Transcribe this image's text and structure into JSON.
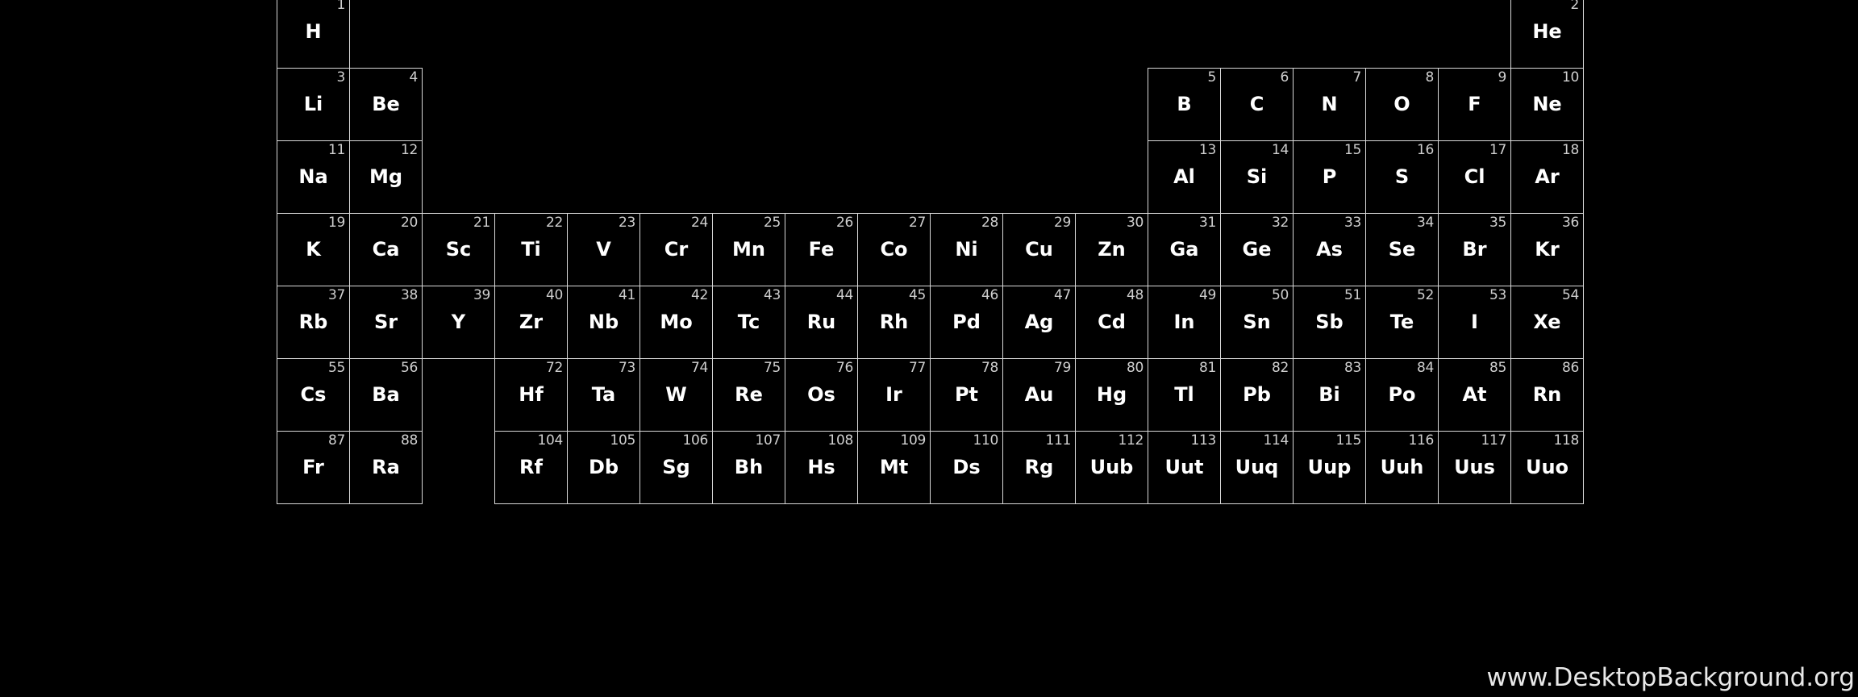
{
  "watermark": "www.DesktopBackground.org",
  "colors": {
    "background": "#000000",
    "grid_line": "#d8d8d8",
    "symbol": "#ffffff",
    "number": "#cfcfcf"
  },
  "elements": [
    {
      "n": "1",
      "s": "H",
      "period": 1,
      "group": 1
    },
    {
      "n": "2",
      "s": "He",
      "period": 1,
      "group": 18
    },
    {
      "n": "3",
      "s": "Li",
      "period": 2,
      "group": 1
    },
    {
      "n": "4",
      "s": "Be",
      "period": 2,
      "group": 2
    },
    {
      "n": "5",
      "s": "B",
      "period": 2,
      "group": 13
    },
    {
      "n": "6",
      "s": "C",
      "period": 2,
      "group": 14
    },
    {
      "n": "7",
      "s": "N",
      "period": 2,
      "group": 15
    },
    {
      "n": "8",
      "s": "O",
      "period": 2,
      "group": 16
    },
    {
      "n": "9",
      "s": "F",
      "period": 2,
      "group": 17
    },
    {
      "n": "10",
      "s": "Ne",
      "period": 2,
      "group": 18
    },
    {
      "n": "11",
      "s": "Na",
      "period": 3,
      "group": 1
    },
    {
      "n": "12",
      "s": "Mg",
      "period": 3,
      "group": 2
    },
    {
      "n": "13",
      "s": "Al",
      "period": 3,
      "group": 13
    },
    {
      "n": "14",
      "s": "Si",
      "period": 3,
      "group": 14
    },
    {
      "n": "15",
      "s": "P",
      "period": 3,
      "group": 15
    },
    {
      "n": "16",
      "s": "S",
      "period": 3,
      "group": 16
    },
    {
      "n": "17",
      "s": "Cl",
      "period": 3,
      "group": 17
    },
    {
      "n": "18",
      "s": "Ar",
      "period": 3,
      "group": 18
    },
    {
      "n": "19",
      "s": "K",
      "period": 4,
      "group": 1
    },
    {
      "n": "20",
      "s": "Ca",
      "period": 4,
      "group": 2
    },
    {
      "n": "21",
      "s": "Sc",
      "period": 4,
      "group": 3
    },
    {
      "n": "22",
      "s": "Ti",
      "period": 4,
      "group": 4
    },
    {
      "n": "23",
      "s": "V",
      "period": 4,
      "group": 5
    },
    {
      "n": "24",
      "s": "Cr",
      "period": 4,
      "group": 6
    },
    {
      "n": "25",
      "s": "Mn",
      "period": 4,
      "group": 7
    },
    {
      "n": "26",
      "s": "Fe",
      "period": 4,
      "group": 8
    },
    {
      "n": "27",
      "s": "Co",
      "period": 4,
      "group": 9
    },
    {
      "n": "28",
      "s": "Ni",
      "period": 4,
      "group": 10
    },
    {
      "n": "29",
      "s": "Cu",
      "period": 4,
      "group": 11
    },
    {
      "n": "30",
      "s": "Zn",
      "period": 4,
      "group": 12
    },
    {
      "n": "31",
      "s": "Ga",
      "period": 4,
      "group": 13
    },
    {
      "n": "32",
      "s": "Ge",
      "period": 4,
      "group": 14
    },
    {
      "n": "33",
      "s": "As",
      "period": 4,
      "group": 15
    },
    {
      "n": "34",
      "s": "Se",
      "period": 4,
      "group": 16
    },
    {
      "n": "35",
      "s": "Br",
      "period": 4,
      "group": 17
    },
    {
      "n": "36",
      "s": "Kr",
      "period": 4,
      "group": 18
    },
    {
      "n": "37",
      "s": "Rb",
      "period": 5,
      "group": 1
    },
    {
      "n": "38",
      "s": "Sr",
      "period": 5,
      "group": 2
    },
    {
      "n": "39",
      "s": "Y",
      "period": 5,
      "group": 3
    },
    {
      "n": "40",
      "s": "Zr",
      "period": 5,
      "group": 4
    },
    {
      "n": "41",
      "s": "Nb",
      "period": 5,
      "group": 5
    },
    {
      "n": "42",
      "s": "Mo",
      "period": 5,
      "group": 6
    },
    {
      "n": "43",
      "s": "Tc",
      "period": 5,
      "group": 7
    },
    {
      "n": "44",
      "s": "Ru",
      "period": 5,
      "group": 8
    },
    {
      "n": "45",
      "s": "Rh",
      "period": 5,
      "group": 9
    },
    {
      "n": "46",
      "s": "Pd",
      "period": 5,
      "group": 10
    },
    {
      "n": "47",
      "s": "Ag",
      "period": 5,
      "group": 11
    },
    {
      "n": "48",
      "s": "Cd",
      "period": 5,
      "group": 12
    },
    {
      "n": "49",
      "s": "In",
      "period": 5,
      "group": 13
    },
    {
      "n": "50",
      "s": "Sn",
      "period": 5,
      "group": 14
    },
    {
      "n": "51",
      "s": "Sb",
      "period": 5,
      "group": 15
    },
    {
      "n": "52",
      "s": "Te",
      "period": 5,
      "group": 16
    },
    {
      "n": "53",
      "s": "I",
      "period": 5,
      "group": 17
    },
    {
      "n": "54",
      "s": "Xe",
      "period": 5,
      "group": 18
    },
    {
      "n": "55",
      "s": "Cs",
      "period": 6,
      "group": 1
    },
    {
      "n": "56",
      "s": "Ba",
      "period": 6,
      "group": 2
    },
    {
      "n": "72",
      "s": "Hf",
      "period": 6,
      "group": 4
    },
    {
      "n": "73",
      "s": "Ta",
      "period": 6,
      "group": 5
    },
    {
      "n": "74",
      "s": "W",
      "period": 6,
      "group": 6
    },
    {
      "n": "75",
      "s": "Re",
      "period": 6,
      "group": 7
    },
    {
      "n": "76",
      "s": "Os",
      "period": 6,
      "group": 8
    },
    {
      "n": "77",
      "s": "Ir",
      "period": 6,
      "group": 9
    },
    {
      "n": "78",
      "s": "Pt",
      "period": 6,
      "group": 10
    },
    {
      "n": "79",
      "s": "Au",
      "period": 6,
      "group": 11
    },
    {
      "n": "80",
      "s": "Hg",
      "period": 6,
      "group": 12
    },
    {
      "n": "81",
      "s": "Tl",
      "period": 6,
      "group": 13
    },
    {
      "n": "82",
      "s": "Pb",
      "period": 6,
      "group": 14
    },
    {
      "n": "83",
      "s": "Bi",
      "period": 6,
      "group": 15
    },
    {
      "n": "84",
      "s": "Po",
      "period": 6,
      "group": 16
    },
    {
      "n": "85",
      "s": "At",
      "period": 6,
      "group": 17
    },
    {
      "n": "86",
      "s": "Rn",
      "period": 6,
      "group": 18
    },
    {
      "n": "87",
      "s": "Fr",
      "period": 7,
      "group": 1
    },
    {
      "n": "88",
      "s": "Ra",
      "period": 7,
      "group": 2
    },
    {
      "n": "104",
      "s": "Rf",
      "period": 7,
      "group": 4
    },
    {
      "n": "105",
      "s": "Db",
      "period": 7,
      "group": 5
    },
    {
      "n": "106",
      "s": "Sg",
      "period": 7,
      "group": 6
    },
    {
      "n": "107",
      "s": "Bh",
      "period": 7,
      "group": 7
    },
    {
      "n": "108",
      "s": "Hs",
      "period": 7,
      "group": 8
    },
    {
      "n": "109",
      "s": "Mt",
      "period": 7,
      "group": 9
    },
    {
      "n": "110",
      "s": "Ds",
      "period": 7,
      "group": 10
    },
    {
      "n": "111",
      "s": "Rg",
      "period": 7,
      "group": 11
    },
    {
      "n": "112",
      "s": "Uub",
      "period": 7,
      "group": 12
    },
    {
      "n": "113",
      "s": "Uut",
      "period": 7,
      "group": 13
    },
    {
      "n": "114",
      "s": "Uuq",
      "period": 7,
      "group": 14
    },
    {
      "n": "115",
      "s": "Uup",
      "period": 7,
      "group": 15
    },
    {
      "n": "116",
      "s": "Uuh",
      "period": 7,
      "group": 16
    },
    {
      "n": "117",
      "s": "Uus",
      "period": 7,
      "group": 17
    },
    {
      "n": "118",
      "s": "Uuo",
      "period": 7,
      "group": 18
    }
  ]
}
